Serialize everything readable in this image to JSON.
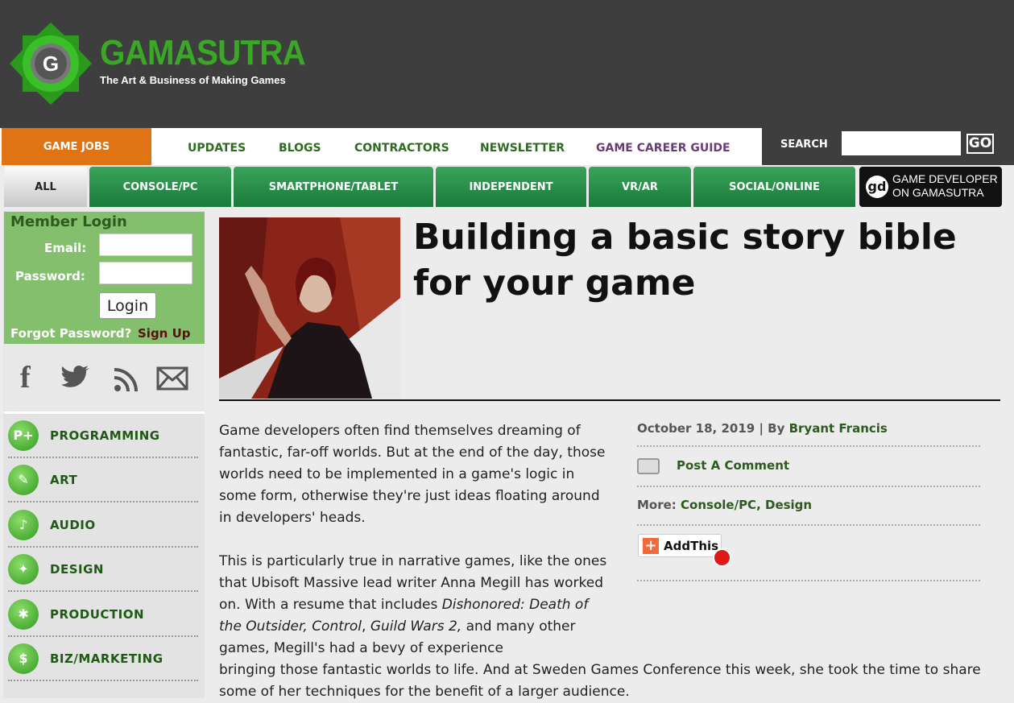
{
  "header": {
    "logo_word": "GAMASUTRA",
    "tagline": "The Art & Business of Making Games"
  },
  "nav_primary": {
    "game_jobs": "GAME JOBS",
    "links": [
      "UPDATES",
      "BLOGS",
      "CONTRACTORS",
      "NEWSLETTER",
      "GAME CAREER GUIDE"
    ],
    "search_label": "SEARCH",
    "search_value": "",
    "search_button": "GO"
  },
  "nav_tabs": {
    "items": [
      "ALL",
      "CONSOLE/PC",
      "SMARTPHONE/TABLET",
      "INDEPENDENT",
      "VR/AR",
      "SOCIAL/ONLINE"
    ],
    "gd_line1": "GAME DEVELOPER",
    "gd_line2": "ON GAMASUTRA",
    "gd_logo": "gd"
  },
  "login": {
    "title": "Member Login",
    "email_label": "Email:",
    "password_label": "Password:",
    "login_button": "Login",
    "forgot": "Forgot Password?",
    "signup": "Sign Up"
  },
  "social": {
    "icons": [
      "facebook-icon",
      "twitter-icon",
      "rss-icon",
      "mail-icon"
    ]
  },
  "categories": [
    "PROGRAMMING",
    "ART",
    "AUDIO",
    "DESIGN",
    "PRODUCTION",
    "BIZ/MARKETING"
  ],
  "article": {
    "headline": "Building a basic story bible for your game",
    "para1": "Game developers often find themselves dreaming of fantastic, far-off worlds. But at the end of the day, those worlds need to be implemented in a game's logic in some form, otherwise they're just ideas floating around in developers' heads.",
    "para2_a": "This is particularly true in narrative games, like the ones that Ubisoft Massive lead writer Anna Megill has worked on. With a resume that includes ",
    "para2_i1": "Dishonored: Death of the Outsider, Control",
    "para2_b": ", ",
    "para2_i2": "Guild Wars 2,",
    "para2_c": " and many other games, Megill's had a bevy of experience",
    "para3": "bringing those fantastic worlds to life. And at Sweden Games Conference this week, she took the time to share some of her techniques for the benefit of a larger audience.",
    "date": "October 18, 2019",
    "by": "| By",
    "author": "Bryant Francis",
    "post_comment": "Post A Comment",
    "more_label": "More:",
    "more_links": "Console/PC, Design",
    "addthis": "AddThis"
  },
  "colors": {
    "header_bg": "#3e3e3e",
    "accent_orange": "#e07414",
    "brand_green": "#3aa826",
    "tab_green": "#1a7a3a",
    "login_bg": "#84bf6e"
  }
}
